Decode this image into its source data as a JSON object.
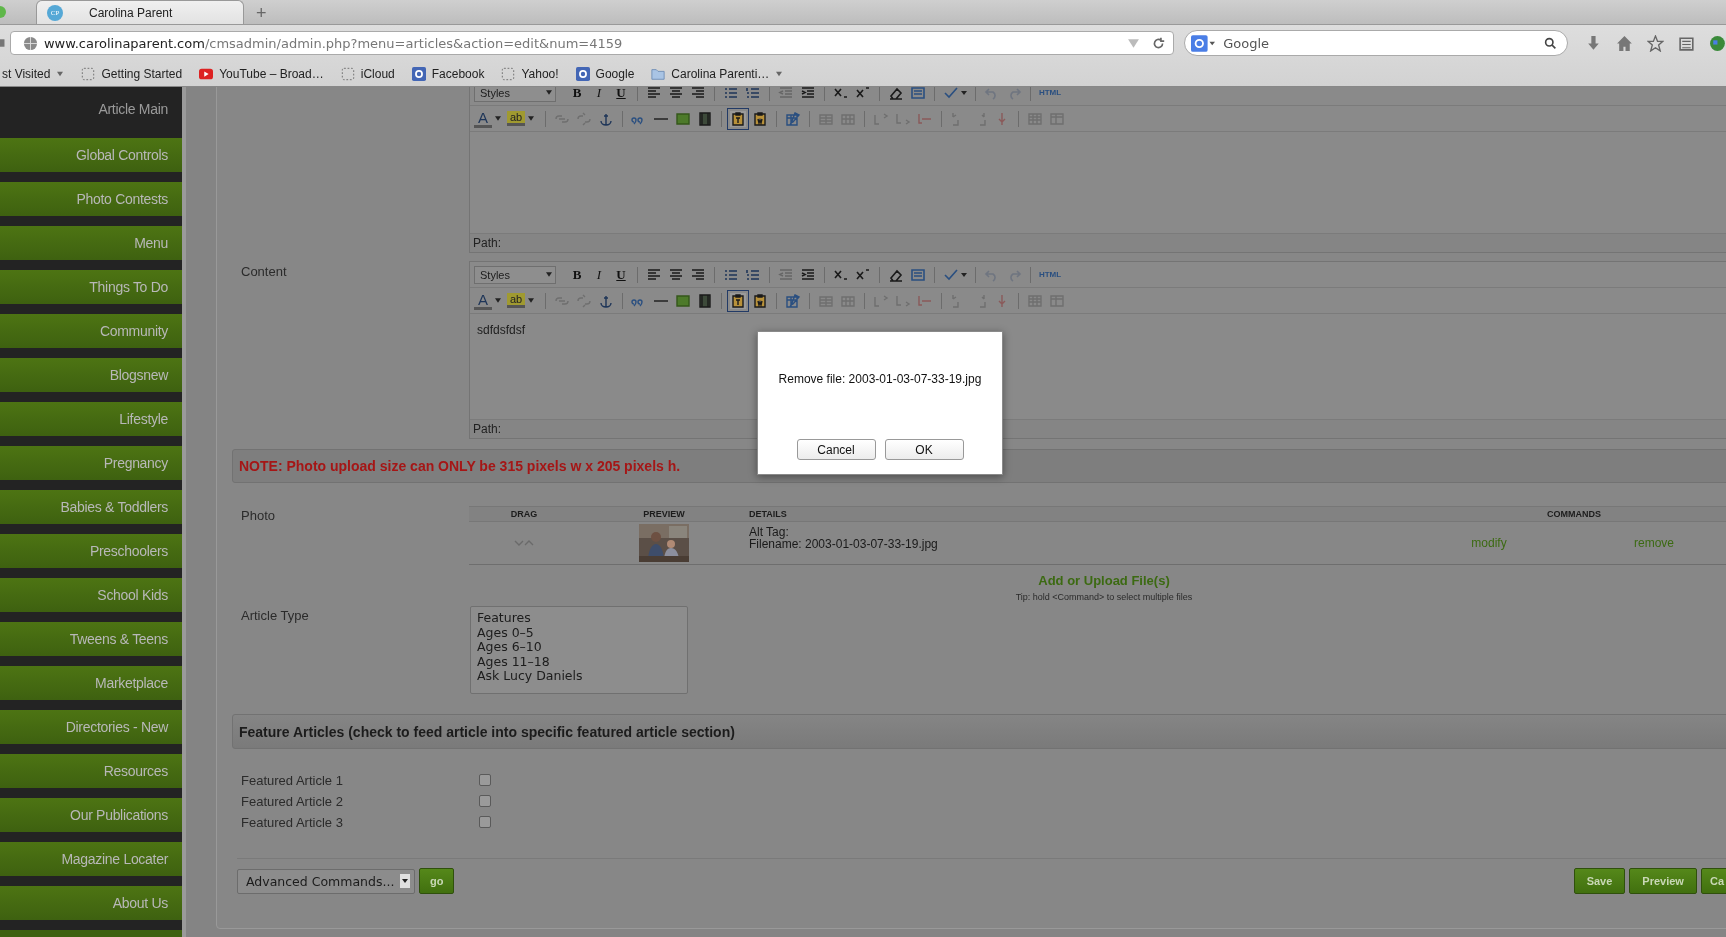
{
  "browser": {
    "tab": {
      "favicon": "CP",
      "title": "Carolina Parent",
      "selected": true
    },
    "new_tab": "+",
    "url_host": "www.carolinaparent.com",
    "url_path": "/cmsadmin/admin.php?menu=articles&action=edit&num=4159",
    "search": {
      "placeholder": "Google"
    },
    "bookmarks": [
      {
        "label": "st Visited",
        "kind": "menu"
      },
      {
        "label": "Getting Started",
        "kind": "blank"
      },
      {
        "label": "YouTube – Broad…",
        "kind": "video"
      },
      {
        "label": "iCloud",
        "kind": "blank"
      },
      {
        "label": "Facebook",
        "kind": "logo"
      },
      {
        "label": "Yahoo!",
        "kind": "blank"
      },
      {
        "label": "Google",
        "kind": "logo"
      },
      {
        "label": "Carolina Parenti…",
        "kind": "folder"
      }
    ]
  },
  "sidebar": {
    "items": [
      {
        "label": "Article Main",
        "selected": true
      },
      {
        "label": "Global Controls",
        "selected": false
      },
      {
        "label": "Photo Contests",
        "selected": false
      },
      {
        "label": "Menu",
        "selected": false
      },
      {
        "label": "Things To Do",
        "selected": false
      },
      {
        "label": "Community",
        "selected": false
      },
      {
        "label": "Blogsnew",
        "selected": false
      },
      {
        "label": "Lifestyle",
        "selected": false
      },
      {
        "label": "Pregnancy",
        "selected": false
      },
      {
        "label": "Babies & Toddlers",
        "selected": false
      },
      {
        "label": "Preschoolers",
        "selected": false
      },
      {
        "label": "School Kids",
        "selected": false
      },
      {
        "label": "Tweens & Teens",
        "selected": false
      },
      {
        "label": "Marketplace",
        "selected": false
      },
      {
        "label": "Directories - New",
        "selected": false
      },
      {
        "label": "Resources",
        "selected": false
      },
      {
        "label": "Our Publications",
        "selected": false
      },
      {
        "label": "Magazine Locater",
        "selected": false
      },
      {
        "label": "About Us",
        "selected": false
      }
    ]
  },
  "editors": [
    {
      "toolbar": {
        "styles": "Styles",
        "bold": "B",
        "italic": "I",
        "underline": "U",
        "html": "HTML",
        "font_color": "A",
        "highlight": "ab"
      },
      "path_label": "Path:"
    },
    {
      "label": "Content",
      "toolbar": {
        "styles": "Styles",
        "bold": "B",
        "italic": "I",
        "underline": "U",
        "html": "HTML",
        "font_color": "A",
        "highlight": "ab"
      },
      "text": "sdfdsfdsf",
      "path_label": "Path:"
    }
  ],
  "note": "NOTE: Photo upload size can ONLY be 315 pixels w x 205 pixels h.",
  "photo": {
    "label": "Photo",
    "columns": [
      "DRAG",
      "PREVIEW",
      "DETAILS",
      "COMMANDS"
    ],
    "rows": [
      {
        "alt_tag": "Alt Tag:",
        "filename": "Filename: 2003-01-03-07-33-19.jpg",
        "modify": "modify",
        "remove": "remove"
      }
    ],
    "add_link": "Add or Upload File(s)",
    "tip": "Tip: hold <Command> to select multiple files"
  },
  "article_type": {
    "label": "Article Type",
    "options": [
      "Features",
      "Ages 0–5",
      "Ages 6–10",
      "Ages 11–18",
      "Ask Lucy Daniels"
    ]
  },
  "feature_section": {
    "title": "Feature Articles (check to feed article into specific featured article section)",
    "items": [
      {
        "label": "Featured Article 1",
        "checked": false
      },
      {
        "label": "Featured Article 2",
        "checked": false
      },
      {
        "label": "Featured Article 3",
        "checked": false
      }
    ]
  },
  "advanced": {
    "value": "Advanced Commands...",
    "go": "go"
  },
  "actions": [
    "Save",
    "Preview",
    "Ca"
  ],
  "dialog": {
    "message": "Remove file: 2003-01-03-07-33-19.jpg",
    "buttons": [
      "Cancel",
      "OK"
    ]
  }
}
